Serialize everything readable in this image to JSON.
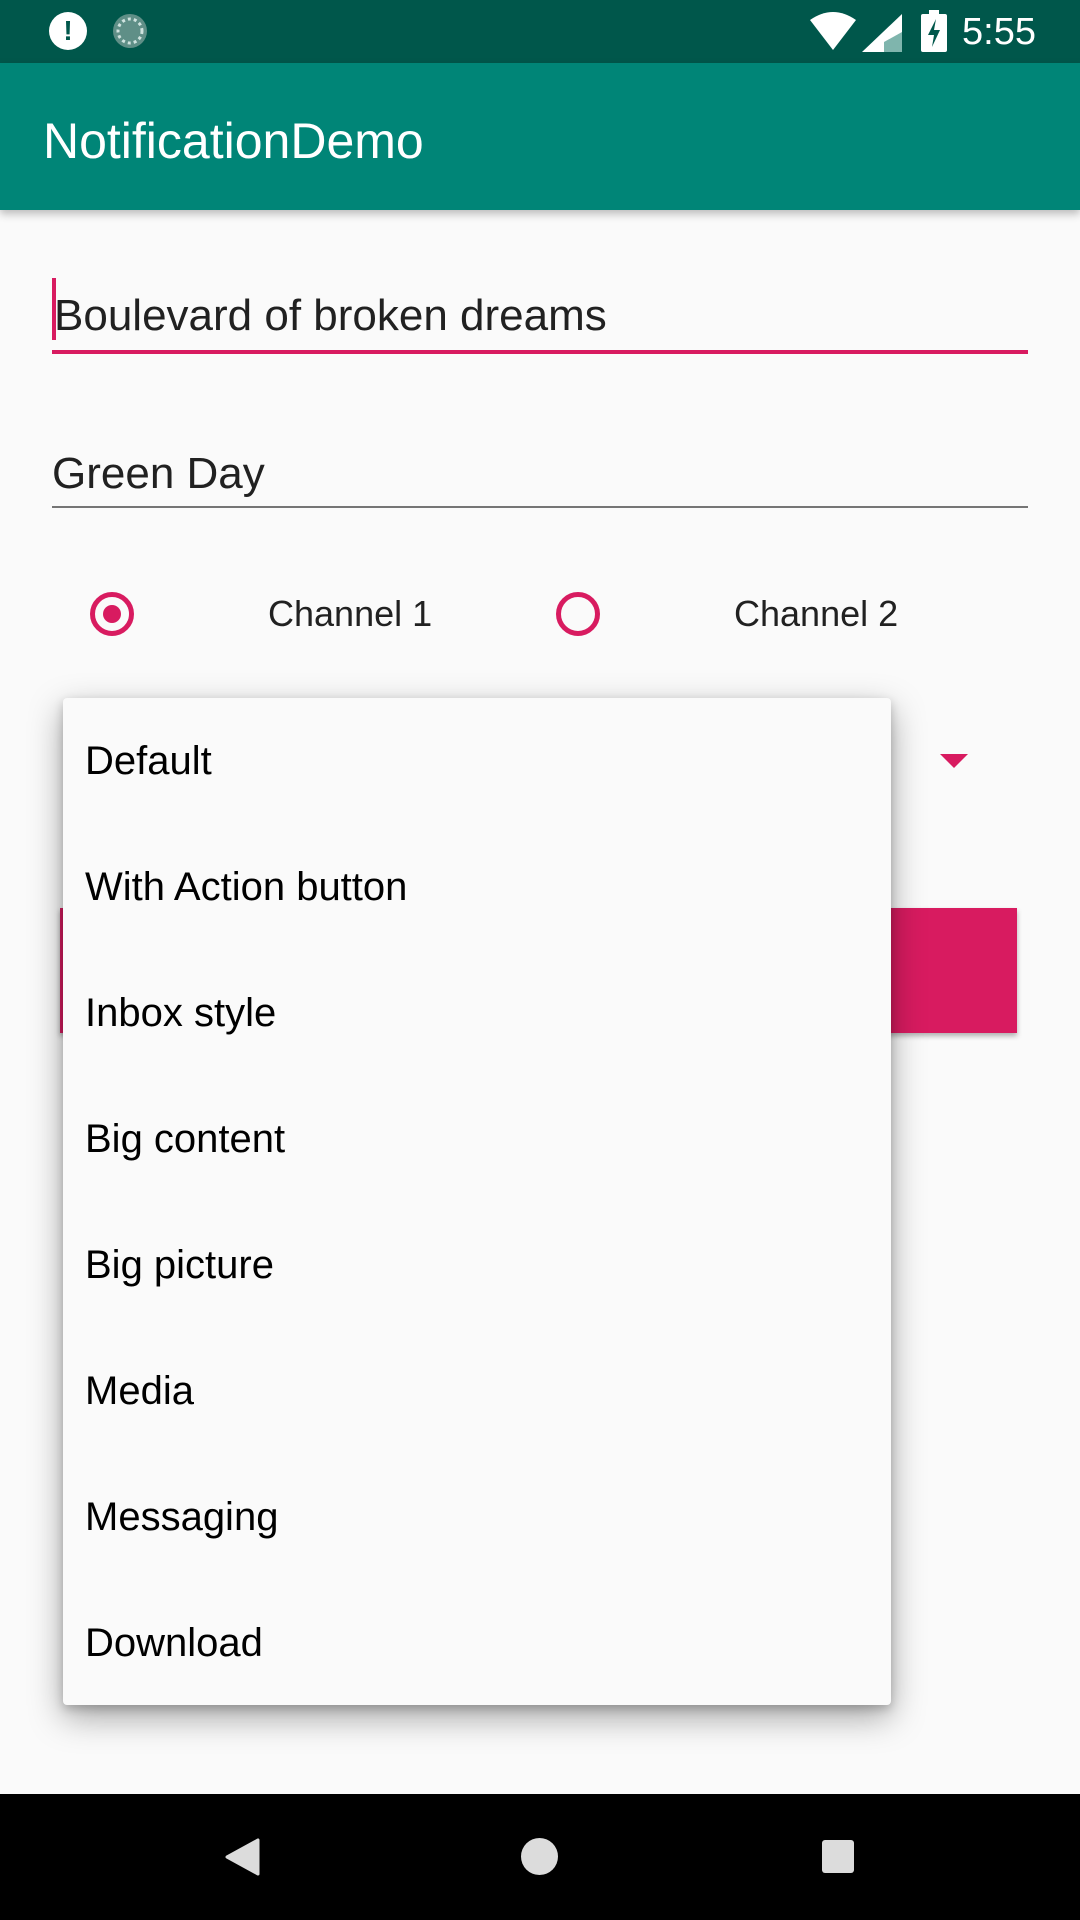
{
  "status_bar": {
    "time": "5:55",
    "icons": [
      "alert-icon",
      "sync-icon",
      "wifi-icon",
      "signal-icon",
      "battery-charging-icon"
    ]
  },
  "app_bar": {
    "title": "NotificationDemo"
  },
  "form": {
    "title_field": {
      "value": "Boulevard of broken dreams"
    },
    "artist_field": {
      "value": "Green Day"
    },
    "channels": [
      {
        "label": "Channel 1",
        "checked": true
      },
      {
        "label": "Channel 2",
        "checked": false
      }
    ]
  },
  "dropdown": {
    "options": [
      "Default",
      "With Action button",
      "Inbox style",
      "Big content",
      "Big picture",
      "Media",
      "Messaging",
      "Download"
    ]
  },
  "colors": {
    "status_bar": "#00574b",
    "app_bar": "#008577",
    "accent": "#d81b60",
    "background": "#fafafa"
  },
  "nav_bar": {
    "icons": [
      "back-icon",
      "home-icon",
      "recents-icon"
    ]
  }
}
